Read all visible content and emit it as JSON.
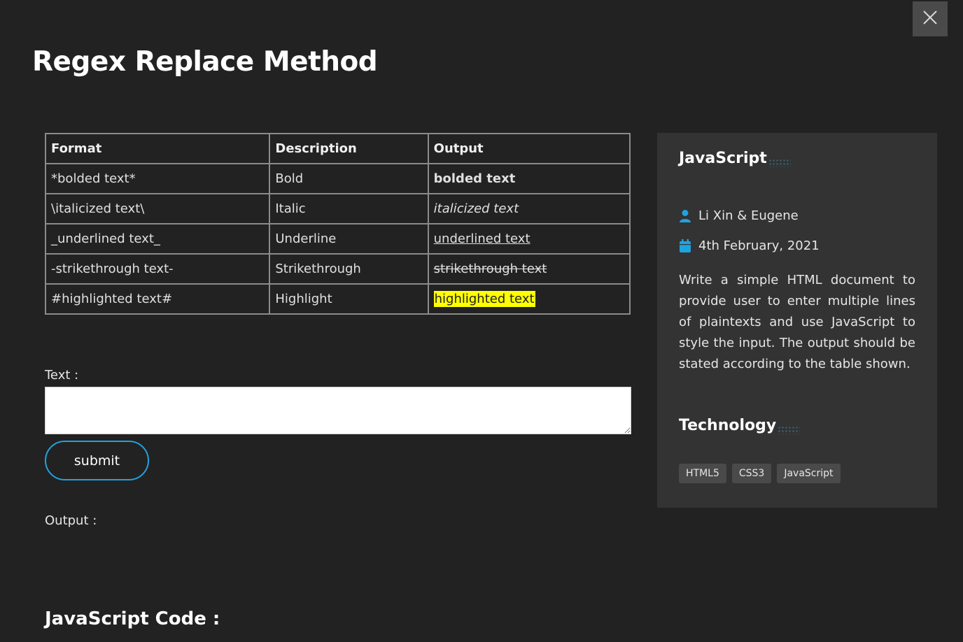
{
  "page": {
    "title": "Regex Replace Method"
  },
  "table": {
    "headers": [
      "Format",
      "Description",
      "Output"
    ],
    "rows": [
      {
        "format": "*bolded text*",
        "description": "Bold",
        "output": "bolded text",
        "style": "bold"
      },
      {
        "format": "\\italicized text\\",
        "description": "Italic",
        "output": "italicized text",
        "style": "italic"
      },
      {
        "format": "_underlined text_",
        "description": "Underline",
        "output": "underlined text",
        "style": "underline"
      },
      {
        "format": "-strikethrough text-",
        "description": "Strikethrough",
        "output": "strikethrough text",
        "style": "strike"
      },
      {
        "format": "#highlighted text#",
        "description": "Highlight",
        "output": "highlighted text",
        "style": "highlight"
      }
    ]
  },
  "form": {
    "text_label": "Text :",
    "text_value": "",
    "submit_label": "submit",
    "output_label": "Output :"
  },
  "code_section": {
    "title": "JavaScript Code :"
  },
  "sidebar": {
    "title": "JavaScript",
    "authors": "Li Xin & Eugene",
    "date": "4th February, 2021",
    "description": "Write a simple HTML document to provide user to enter multiple lines of plaintexts and use JavaScript to style the input. The output should be stated according to the table shown.",
    "technology_title": "Technology",
    "tags": [
      "HTML5",
      "CSS3",
      "JavaScript"
    ]
  },
  "colors": {
    "background": "#222222",
    "sidebar_background": "#333333",
    "accent": "#1fa3e0",
    "highlight": "#ffff00"
  },
  "icons": {
    "close": "close-icon",
    "author": "user-icon",
    "date": "calendar-icon"
  }
}
